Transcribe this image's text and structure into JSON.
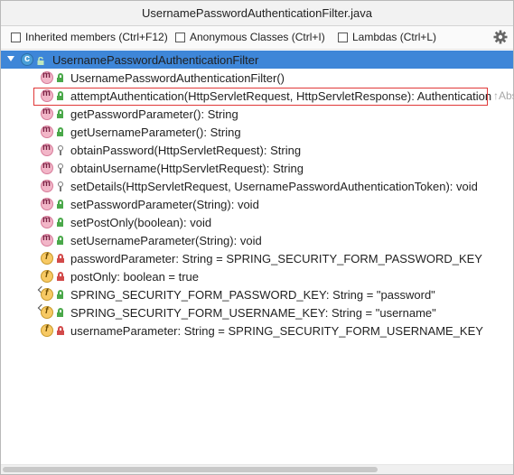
{
  "window": {
    "title": "UsernamePasswordAuthenticationFilter.java"
  },
  "toolbar": {
    "inherited": "Inherited members (Ctrl+F12)",
    "anonymous": "Anonymous Classes (Ctrl+I)",
    "lambdas": "Lambdas (Ctrl+L)"
  },
  "tree": {
    "root": "UsernamePasswordAuthenticationFilter",
    "items": [
      {
        "kind": "method",
        "access": "public",
        "label": "UsernamePasswordAuthenticationFilter()"
      },
      {
        "kind": "method",
        "access": "public",
        "label": "attemptAuthentication(HttpServletRequest, HttpServletResponse): Authentication",
        "hint": "↑Abs"
      },
      {
        "kind": "method",
        "access": "public",
        "label": "getPasswordParameter(): String"
      },
      {
        "kind": "method",
        "access": "public",
        "label": "getUsernameParameter(): String"
      },
      {
        "kind": "method",
        "access": "protected",
        "label": "obtainPassword(HttpServletRequest): String"
      },
      {
        "kind": "method",
        "access": "protected",
        "label": "obtainUsername(HttpServletRequest): String"
      },
      {
        "kind": "method",
        "access": "protected",
        "label": "setDetails(HttpServletRequest, UsernamePasswordAuthenticationToken): void"
      },
      {
        "kind": "method",
        "access": "public",
        "label": "setPasswordParameter(String): void"
      },
      {
        "kind": "method",
        "access": "public",
        "label": "setPostOnly(boolean): void"
      },
      {
        "kind": "method",
        "access": "public",
        "label": "setUsernameParameter(String): void"
      },
      {
        "kind": "field",
        "access": "private",
        "label": "passwordParameter: String = SPRING_SECURITY_FORM_PASSWORD_KEY"
      },
      {
        "kind": "field",
        "access": "private",
        "label": "postOnly: boolean = true"
      },
      {
        "kind": "field",
        "access": "public",
        "static": true,
        "label": "SPRING_SECURITY_FORM_PASSWORD_KEY: String = \"password\""
      },
      {
        "kind": "field",
        "access": "public",
        "static": true,
        "label": "SPRING_SECURITY_FORM_USERNAME_KEY: String = \"username\""
      },
      {
        "kind": "field",
        "access": "private",
        "label": "usernameParameter: String = SPRING_SECURITY_FORM_USERNAME_KEY"
      }
    ]
  },
  "colors": {
    "selection": "#3e86d8",
    "highlight": "#e03838"
  },
  "icons": {
    "settings": "gear-icon"
  }
}
